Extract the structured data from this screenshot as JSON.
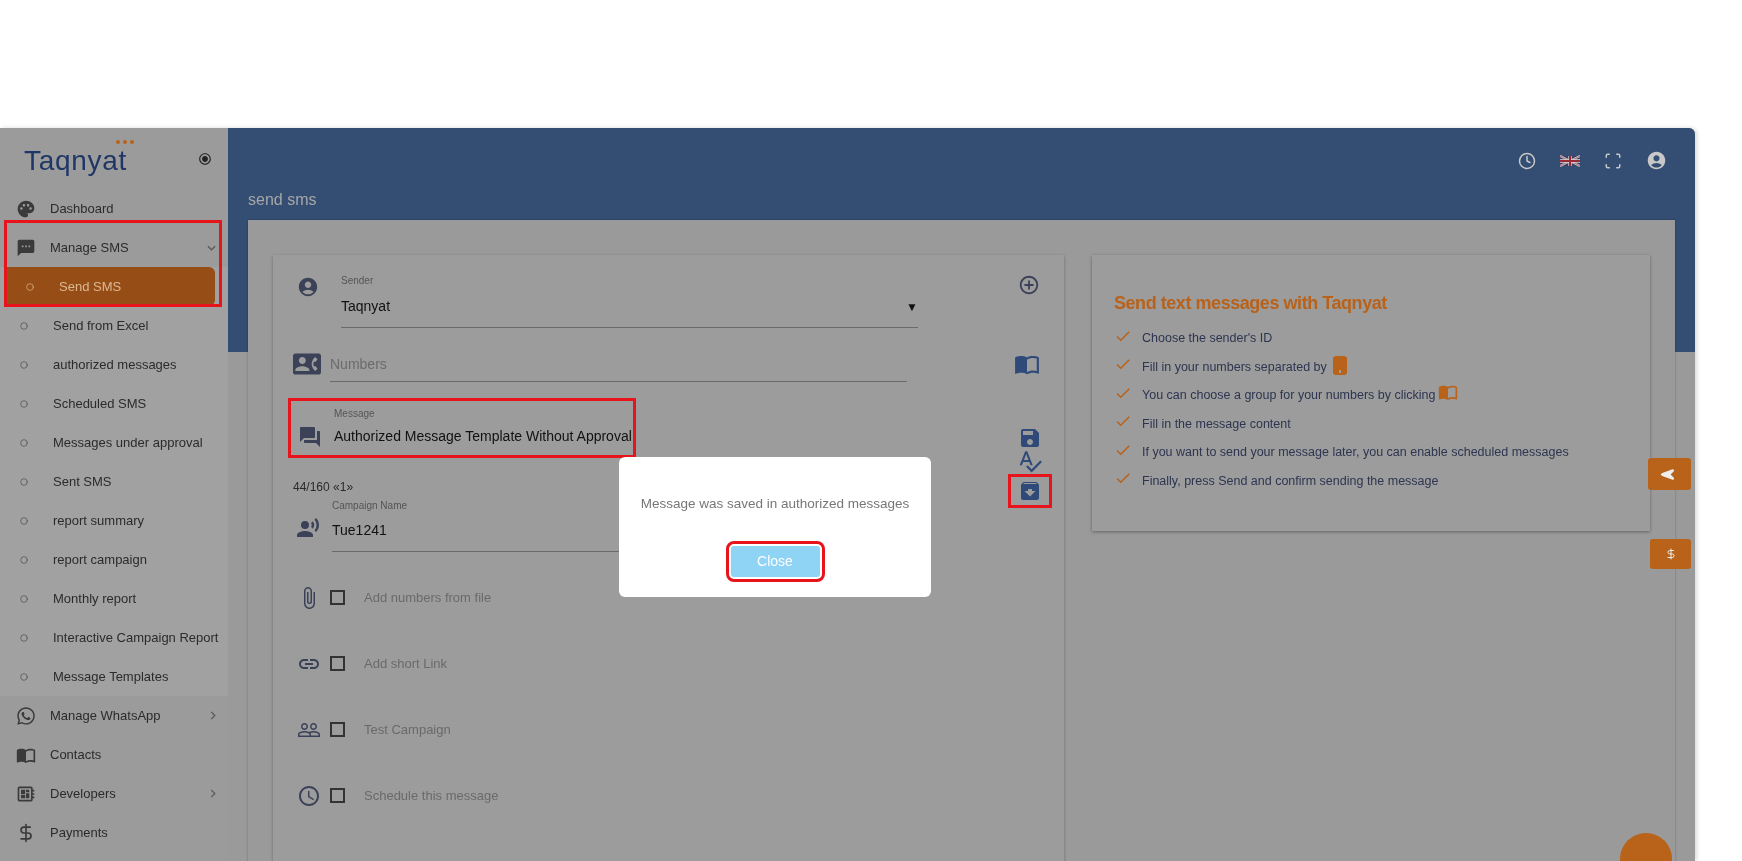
{
  "logo": {
    "text": "Taqnyat"
  },
  "sidebar": {
    "items": [
      {
        "label": "Dashboard",
        "selected": false
      },
      {
        "label": "Manage SMS",
        "selected": false,
        "expanded": true,
        "children": [
          {
            "label": "Send SMS",
            "selected": true
          },
          {
            "label": "Send from Excel",
            "selected": false
          },
          {
            "label": "authorized messages",
            "selected": false
          },
          {
            "label": "Scheduled SMS",
            "selected": false
          },
          {
            "label": "Messages under approval",
            "selected": false
          },
          {
            "label": "Sent SMS",
            "selected": false
          },
          {
            "label": "report summary",
            "selected": false
          },
          {
            "label": "report campaign",
            "selected": false
          },
          {
            "label": "Monthly report",
            "selected": false
          },
          {
            "label": "Interactive Campaign Report",
            "selected": false
          },
          {
            "label": "Message Templates",
            "selected": false
          }
        ]
      },
      {
        "label": "Manage WhatsApp",
        "selected": false,
        "expanded": false
      },
      {
        "label": "Contacts",
        "selected": false
      },
      {
        "label": "Developers",
        "selected": false,
        "expanded": false
      },
      {
        "label": "Payments",
        "selected": false
      }
    ]
  },
  "page_title": "send sms",
  "form": {
    "sender": {
      "label": "Sender",
      "value": "Taqnyat",
      "dropdown_arrow": "▼"
    },
    "numbers": {
      "placeholder": "Numbers"
    },
    "message": {
      "label": "Message",
      "value": "Authorized Message Template Without Approval"
    },
    "counter": "44/160 «1»",
    "campaign": {
      "label": "Campaign Name",
      "value": "Tue1241"
    },
    "options": [
      {
        "label": "Add numbers from file",
        "checked": false
      },
      {
        "label": "Add short Link",
        "checked": false
      },
      {
        "label": "Test Campaign",
        "checked": false
      },
      {
        "label": "Schedule this message",
        "checked": false
      }
    ]
  },
  "info_card": {
    "title": "Send text messages with Taqnyat",
    "steps": [
      {
        "text": "Choose the sender's ID",
        "kind": "plain"
      },
      {
        "text": "Fill in your numbers separated by",
        "kind": "comma_key"
      },
      {
        "text": "You can choose a group for your numbers by clicking",
        "kind": "book"
      },
      {
        "text": "Fill in the message content",
        "kind": "plain"
      },
      {
        "text": "If you want to send your message later, you can enable scheduled messages",
        "kind": "plain"
      },
      {
        "text": "Finally, press Send and confirm sending the message",
        "kind": "plain"
      }
    ]
  },
  "dialog": {
    "message": "Message was saved in authorized messages",
    "button": "Close"
  }
}
